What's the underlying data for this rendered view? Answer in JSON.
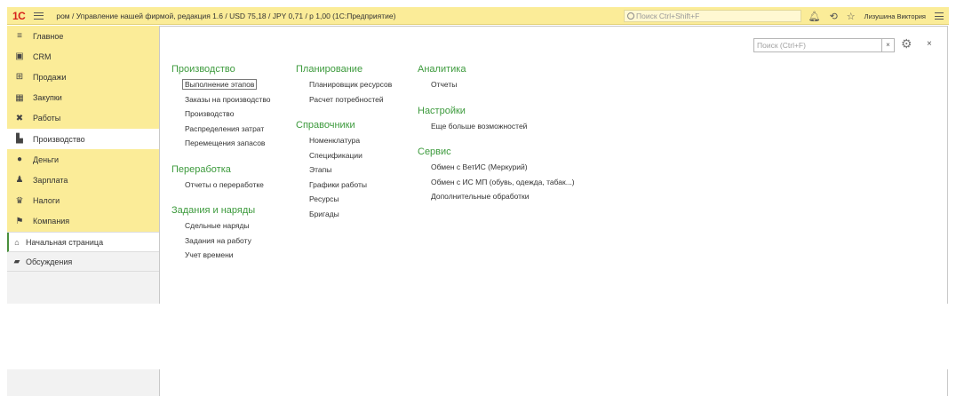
{
  "titlebar": {
    "logo": "1С",
    "title": "ром / Управление нашей фирмой, редакция 1.6 / USD 75,18 / JPY 0,71 / р 1,00  (1С:Предприятие)",
    "search_placeholder": "Поиск Ctrl+Shift+F",
    "user": "Лизушина Виктория"
  },
  "sidebar": {
    "items": [
      {
        "label": "Главное",
        "icon": "menu-lines-icon"
      },
      {
        "label": "CRM",
        "icon": "crm-icon"
      },
      {
        "label": "Продажи",
        "icon": "cart-icon"
      },
      {
        "label": "Закупки",
        "icon": "purchases-icon"
      },
      {
        "label": "Работы",
        "icon": "tools-icon"
      },
      {
        "label": "Производство",
        "icon": "factory-icon"
      },
      {
        "label": "Деньги",
        "icon": "money-icon"
      },
      {
        "label": "Зарплата",
        "icon": "salary-icon"
      },
      {
        "label": "Налоги",
        "icon": "taxes-icon"
      },
      {
        "label": "Компания",
        "icon": "flag-icon"
      }
    ],
    "active": "Производство",
    "home": "Начальная страница",
    "discussions": "Обсуждения"
  },
  "main": {
    "search_placeholder": "Поиск (Ctrl+F)",
    "clear_label": "×",
    "close_label": "×",
    "columns": [
      {
        "groups": [
          {
            "title": "Производство",
            "links": [
              "Выполнение этапов",
              "Заказы на производство",
              "Производство",
              "Распределения затрат",
              "Перемещения запасов"
            ]
          },
          {
            "title": "Переработка",
            "links": [
              "Отчеты о переработке"
            ]
          },
          {
            "title": "Задания и наряды",
            "links": [
              "Сдельные наряды",
              "Задания на работу",
              "Учет времени"
            ]
          }
        ]
      },
      {
        "groups": [
          {
            "title": "Планирование",
            "links": [
              "Планировщик ресурсов",
              "Расчет потребностей"
            ]
          },
          {
            "title": "Справочники",
            "links": [
              "Номенклатура",
              "Спецификации",
              "Этапы",
              "Графики работы",
              "Ресурсы",
              "Бригады"
            ]
          }
        ]
      },
      {
        "groups": [
          {
            "title": "Аналитика",
            "links": [
              "Отчеты"
            ]
          },
          {
            "title": "Настройки",
            "links": [
              "Еще больше возможностей"
            ]
          },
          {
            "title": "Сервис",
            "links": [
              "Обмен с ВетИС (Меркурий)",
              "Обмен с ИС МП (обувь, одежда, табак...)",
              "Дополнительные обработки"
            ]
          }
        ]
      }
    ]
  },
  "colors": {
    "accent": "#fbec98",
    "group_title": "#3c9a3c",
    "logo": "#d6201b"
  }
}
